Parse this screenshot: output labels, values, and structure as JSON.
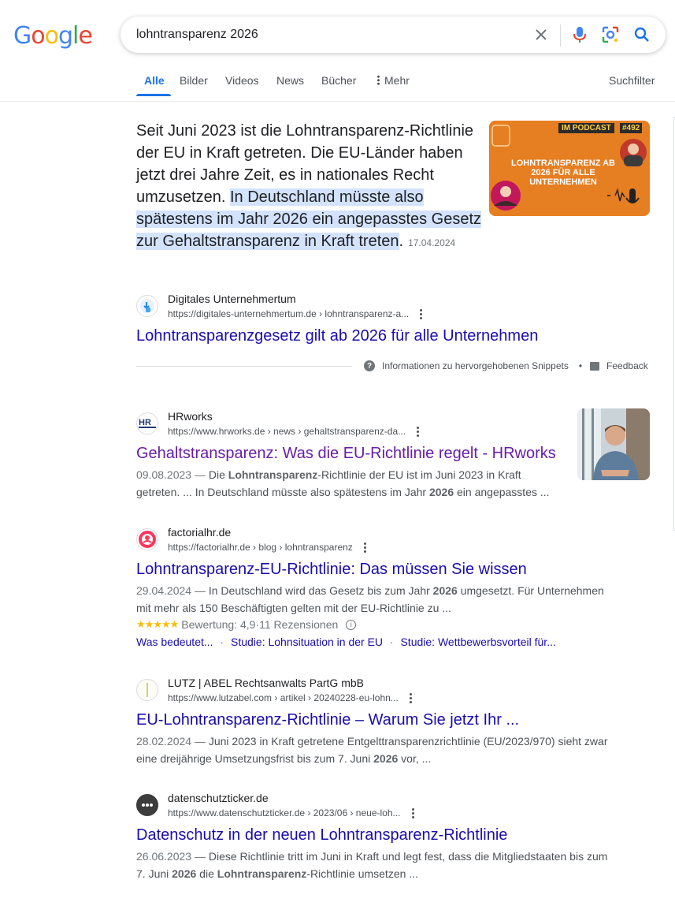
{
  "logo": {
    "letters": [
      "G",
      "o",
      "o",
      "g",
      "l",
      "e"
    ]
  },
  "search": {
    "query": "lohntransparenz 2026"
  },
  "tabs": [
    {
      "label": "Alle"
    },
    {
      "label": "Bilder"
    },
    {
      "label": "Videos"
    },
    {
      "label": "News"
    },
    {
      "label": "Bücher"
    },
    {
      "label": "Mehr"
    }
  ],
  "suchfilter": "Suchfilter",
  "featured": {
    "text_plain": "Seit Juni 2023 ist die Lohntransparenz-Richtlinie der EU in Kraft getreten. Die EU-Länder haben jetzt drei Jahre Zeit, es in nationales Recht umzusetzen. ",
    "text_highlight": "In Deutschland müsste also spätestens im Jahr 2026 ein angepasstes Gesetz zur Gehaltstransparenz in Kraft treten",
    "text_end": ".",
    "date": "17.04.2024",
    "image": {
      "badge": "IM PODCAST",
      "number": "#492",
      "title": "LOHNTRANSPARENZ AB 2026 FÜR ALLE UNTERNEHMEN"
    },
    "site_name": "Digitales Unternehmertum",
    "url": "https://digitales-unternehmertum.de › lohntransparenz-a...",
    "title": "Lohntransparenzgesetz gilt ab 2026 für alle Unternehmen",
    "info_label": "Informationen zu hervorgehobenen Snippets",
    "bullet": "•",
    "feedback_label": "Feedback"
  },
  "results": [
    {
      "site_name": "HRworks",
      "url": "https://www.hrworks.de › news › gehaltstransparenz-da...",
      "title": "Gehaltstransparenz: Was die EU-Richtlinie regelt - HRworks",
      "date": "09.08.2023",
      "d1": "Die ",
      "b1": "Lohntransparenz",
      "d2": "-Richtlinie der EU ist im Juni 2023 in Kraft getreten. ... In Deutschland müsste also spätestens im Jahr ",
      "b2": "2026",
      "d3": " ein angepasstes ..."
    },
    {
      "site_name": "factorialhr.de",
      "url": "https://factorialhr.de › blog › lohntransparenz",
      "title": "Lohntransparenz-EU-Richtlinie: Das müssen Sie wissen",
      "date": "29.04.2024",
      "d1": "In Deutschland wird das Gesetz bis zum Jahr ",
      "b1": "2026",
      "d2": " umgesetzt. Für Unternehmen mit mehr als 150 Beschäftigten gelten mit der EU-Richtlinie zu ...",
      "rating_label": "Bewertung: 4,9",
      "rating_value": 4.9,
      "rating_count": "11 Rezensionen",
      "sitelinks": [
        "Was bedeutet...",
        "Studie: Lohnsituation in der EU",
        "Studie: Wettbewerbsvorteil für..."
      ]
    },
    {
      "site_name": "LUTZ | ABEL Rechtsanwalts PartG mbB",
      "url": "https://www.lutzabel.com › artikel › 20240228-eu-lohn...",
      "title": "EU-Lohntransparenz-Richtlinie – Warum Sie jetzt Ihr ...",
      "date": "28.02.2024",
      "d1": "Juni 2023 in Kraft getretene Entgelttransparenzrichtlinie (EU/2023/970) sieht zwar eine dreijährige Umsetzungsfrist bis zum 7. Juni ",
      "b1": "2026",
      "d2": " vor, ..."
    },
    {
      "site_name": "datenschutzticker.de",
      "url": "https://www.datenschutzticker.de › 2023/06 › neue-loh...",
      "title": "Datenschutz in der neuen Lohntransparenz-Richtlinie",
      "date": "26.06.2023",
      "d1": "Diese Richtlinie tritt im Juni in Kraft und legt fest, dass die Mitgliedstaaten bis zum 7. Juni ",
      "b1": "2026",
      "d2": " die ",
      "b2": "Lohntransparenz",
      "d3": "-Richtlinie umsetzen ..."
    }
  ],
  "date_sep": " — ",
  "rating_sep": " · ",
  "colors": {
    "link": "#1a0dab",
    "visited": "#681da8",
    "accent": "#1a73e8",
    "highlight": "#d3e3fd",
    "star": "#fbbc04"
  }
}
